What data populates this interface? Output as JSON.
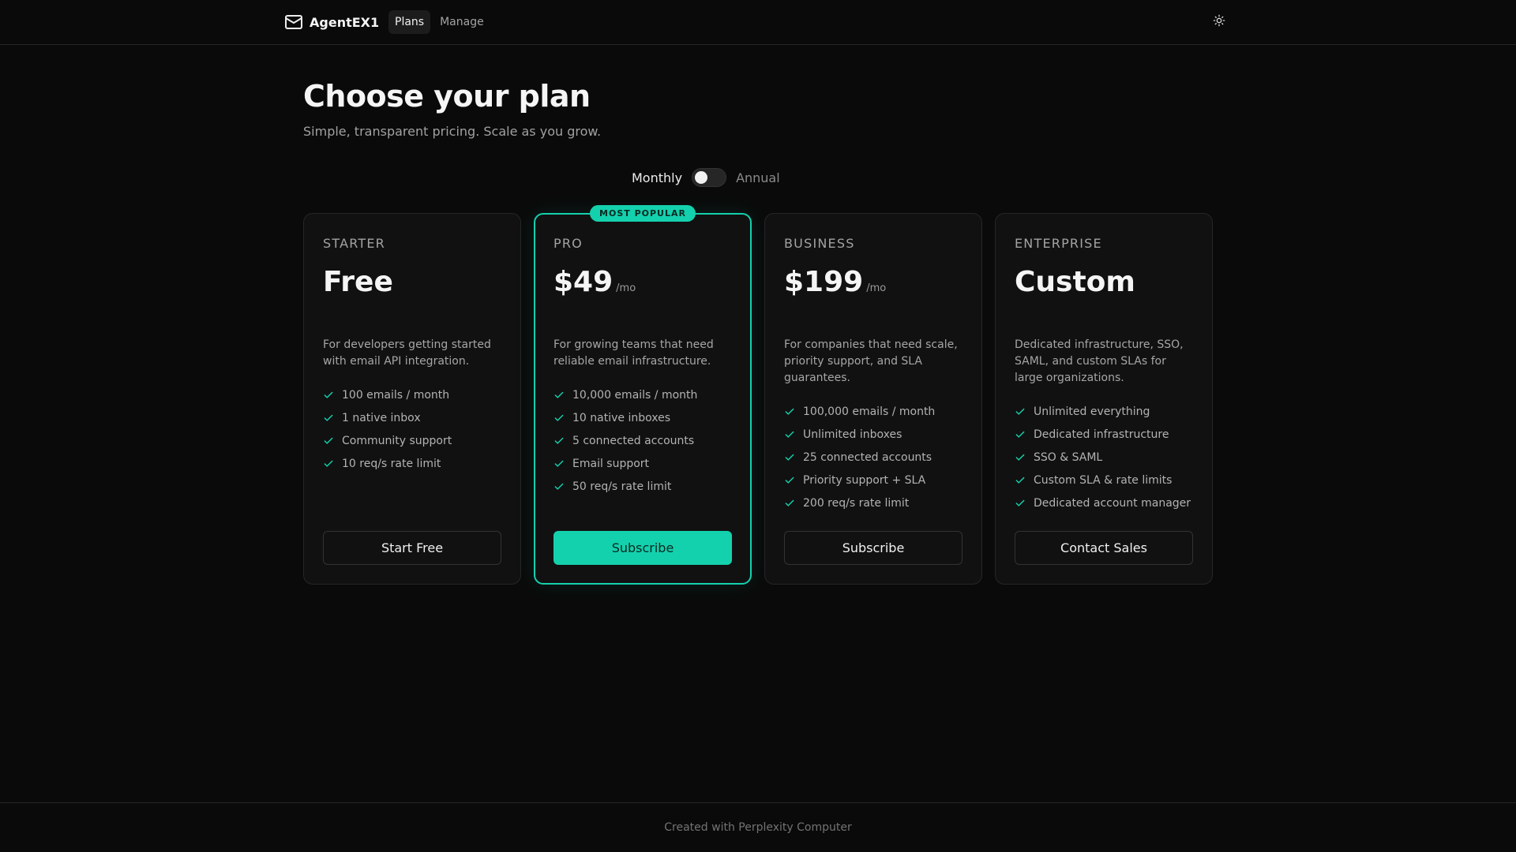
{
  "header": {
    "brand": "AgentEX1",
    "brand_icon": "mail-icon",
    "nav": [
      {
        "label": "Plans",
        "active": true
      },
      {
        "label": "Manage",
        "active": false
      }
    ],
    "theme_icon": "sun-icon"
  },
  "hero": {
    "title": "Choose your plan",
    "subtitle": "Simple, transparent pricing. Scale as you grow."
  },
  "billing": {
    "monthly_label": "Monthly",
    "annual_label": "Annual",
    "selected": "Monthly"
  },
  "colors": {
    "accent": "#14d1ad",
    "background": "#0a0a0a",
    "card": "#111111"
  },
  "plans": [
    {
      "tier": "STARTER",
      "price": "Free",
      "period": "",
      "description": "For developers getting started with email API integration.",
      "features": [
        "100 emails / month",
        "1 native inbox",
        "Community support",
        "10 req/s rate limit"
      ],
      "cta": "Start Free"
    },
    {
      "tier": "PRO",
      "badge": "MOST POPULAR",
      "price": "$49",
      "period": "/mo",
      "description": "For growing teams that need reliable email infrastructure.",
      "features": [
        "10,000 emails / month",
        "10 native inboxes",
        "5 connected accounts",
        "Email support",
        "50 req/s rate limit"
      ],
      "cta": "Subscribe"
    },
    {
      "tier": "BUSINESS",
      "price": "$199",
      "period": "/mo",
      "description": "For companies that need scale, priority support, and SLA guarantees.",
      "features": [
        "100,000 emails / month",
        "Unlimited inboxes",
        "25 connected accounts",
        "Priority support + SLA",
        "200 req/s rate limit"
      ],
      "cta": "Subscribe"
    },
    {
      "tier": "ENTERPRISE",
      "price": "Custom",
      "period": "",
      "description": "Dedicated infrastructure, SSO, SAML, and custom SLAs for large organizations.",
      "features": [
        "Unlimited everything",
        "Dedicated infrastructure",
        "SSO & SAML",
        "Custom SLA & rate limits",
        "Dedicated account manager"
      ],
      "cta": "Contact Sales"
    }
  ],
  "footer": {
    "text": "Created with Perplexity Computer"
  }
}
